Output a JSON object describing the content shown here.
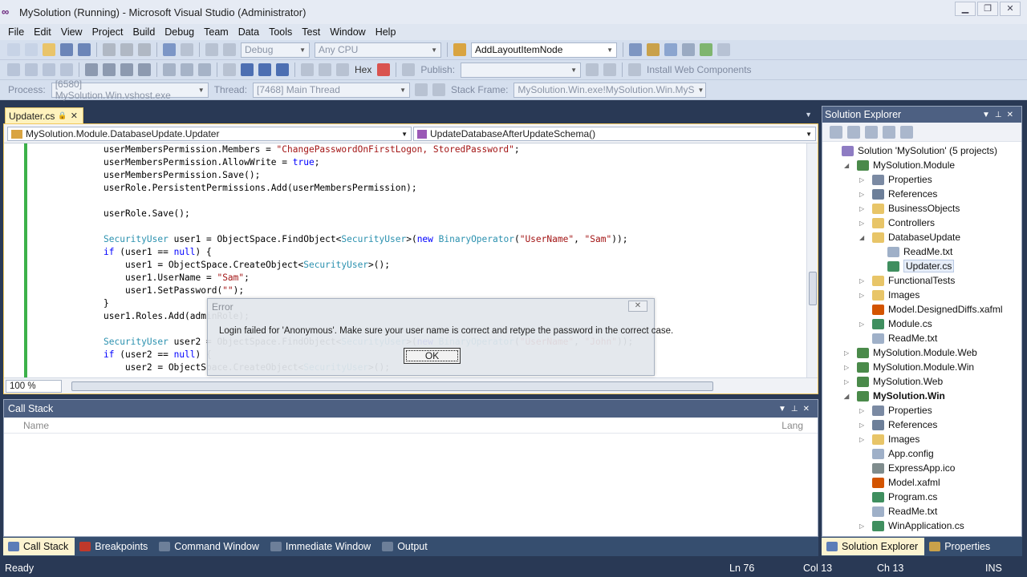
{
  "window": {
    "title": "MySolution (Running) - Microsoft Visual Studio (Administrator)"
  },
  "menu": [
    "File",
    "Edit",
    "View",
    "Project",
    "Build",
    "Debug",
    "Team",
    "Data",
    "Tools",
    "Test",
    "Window",
    "Help"
  ],
  "toolbar1": {
    "config": "Debug",
    "platform": "Any CPU",
    "find": "AddLayoutItemNode"
  },
  "toolbar2": {
    "hex": "Hex",
    "publish_label": "Publish:",
    "install": "Install Web Components"
  },
  "toolbar3": {
    "process_label": "Process:",
    "process": "[6580] MySolution.Win.vshost.exe",
    "thread_label": "Thread:",
    "thread": "[7468] Main Thread",
    "frame_label": "Stack Frame:",
    "frame": "MySolution.Win.exe!MySolution.Win.MyS"
  },
  "doc_tab": {
    "label": "Updater.cs"
  },
  "nav": {
    "type": "MySolution.Module.DatabaseUpdate.Updater",
    "member": "UpdateDatabaseAfterUpdateSchema()"
  },
  "code": [
    "userMembersPermission.Members = \"ChangePasswordOnFirstLogon, StoredPassword\";",
    "userMembersPermission.AllowWrite = true;",
    "userMembersPermission.Save();",
    "userRole.PersistentPermissions.Add(userMembersPermission);",
    "",
    "userRole.Save();",
    "",
    "SecurityUser user1 = ObjectSpace.FindObject<SecurityUser>(new BinaryOperator(\"UserName\", \"Sam\"));",
    "if (user1 == null) {",
    "    user1 = ObjectSpace.CreateObject<SecurityUser>();",
    "    user1.UserName = \"Sam\";",
    "    user1.SetPassword(\"\");",
    "}",
    "user1.Roles.Add(adminRole);",
    "",
    "SecurityUser user2 = ObjectSpace.FindObject<SecurityUser>(new BinaryOperator(\"UserName\", \"John\"));",
    "if (user2 == null) {",
    "    user2 = ObjectSpace.CreateObject<SecurityUser>();"
  ],
  "zoom": "100 %",
  "dialog": {
    "title": "Error",
    "message": "Login failed for 'Anonymous'. Make sure your user name is correct and retype the password in the correct case.",
    "ok": "OK"
  },
  "callstack": {
    "title": "Call Stack",
    "col_name": "Name",
    "col_lang": "Lang"
  },
  "bottom_tabs": [
    "Call Stack",
    "Breakpoints",
    "Command Window",
    "Immediate Window",
    "Output"
  ],
  "solution_explorer": {
    "title": "Solution Explorer",
    "items": [
      {
        "label": "Solution 'MySolution' (5 projects)",
        "level": 0,
        "expand": "",
        "icon": "solution"
      },
      {
        "label": "MySolution.Module",
        "level": 1,
        "expand": "open",
        "icon": "csproject"
      },
      {
        "label": "Properties",
        "level": 2,
        "expand": "closed",
        "icon": "properties"
      },
      {
        "label": "References",
        "level": 2,
        "expand": "closed",
        "icon": "references"
      },
      {
        "label": "BusinessObjects",
        "level": 2,
        "expand": "closed",
        "icon": "folder"
      },
      {
        "label": "Controllers",
        "level": 2,
        "expand": "closed",
        "icon": "folder"
      },
      {
        "label": "DatabaseUpdate",
        "level": 2,
        "expand": "open",
        "icon": "folder-open"
      },
      {
        "label": "ReadMe.txt",
        "level": 3,
        "expand": "",
        "icon": "text-file"
      },
      {
        "label": "Updater.cs",
        "level": 3,
        "expand": "",
        "icon": "cs-file"
      },
      {
        "label": "FunctionalTests",
        "level": 2,
        "expand": "closed",
        "icon": "folder"
      },
      {
        "label": "Images",
        "level": 2,
        "expand": "closed",
        "icon": "folder"
      },
      {
        "label": "Model.DesignedDiffs.xafml",
        "level": 2,
        "expand": "",
        "icon": "model"
      },
      {
        "label": "Module.cs",
        "level": 2,
        "expand": "closed",
        "icon": "cs-file"
      },
      {
        "label": "ReadMe.txt",
        "level": 2,
        "expand": "",
        "icon": "text-file"
      },
      {
        "label": "MySolution.Module.Web",
        "level": 1,
        "expand": "closed",
        "icon": "csproject"
      },
      {
        "label": "MySolution.Module.Win",
        "level": 1,
        "expand": "closed",
        "icon": "csproject"
      },
      {
        "label": "MySolution.Web",
        "level": 1,
        "expand": "closed",
        "icon": "webproject"
      },
      {
        "label": "MySolution.Win",
        "level": 1,
        "expand": "open",
        "icon": "csproject"
      },
      {
        "label": "Properties",
        "level": 2,
        "expand": "closed",
        "icon": "properties"
      },
      {
        "label": "References",
        "level": 2,
        "expand": "closed",
        "icon": "references"
      },
      {
        "label": "Images",
        "level": 2,
        "expand": "closed",
        "icon": "folder"
      },
      {
        "label": "App.config",
        "level": 2,
        "expand": "",
        "icon": "config"
      },
      {
        "label": "ExpressApp.ico",
        "level": 2,
        "expand": "",
        "icon": "ico"
      },
      {
        "label": "Model.xafml",
        "level": 2,
        "expand": "",
        "icon": "model"
      },
      {
        "label": "Program.cs",
        "level": 2,
        "expand": "",
        "icon": "cs-file"
      },
      {
        "label": "ReadMe.txt",
        "level": 2,
        "expand": "",
        "icon": "text-file"
      },
      {
        "label": "WinApplication.cs",
        "level": 2,
        "expand": "closed",
        "icon": "cs-file"
      }
    ],
    "tabs": [
      "Solution Explorer",
      "Properties"
    ]
  },
  "status": {
    "ready": "Ready",
    "ln": "Ln 76",
    "col": "Col 13",
    "ch": "Ch 13",
    "ins": "INS"
  },
  "colors": {
    "titlebar": "#e6ebf4",
    "frame": "#293955",
    "panel_head": "#4d6082",
    "keyword": "#0000ff",
    "type": "#2b91af",
    "string": "#a31515",
    "active_tab": "#fff2bd"
  }
}
